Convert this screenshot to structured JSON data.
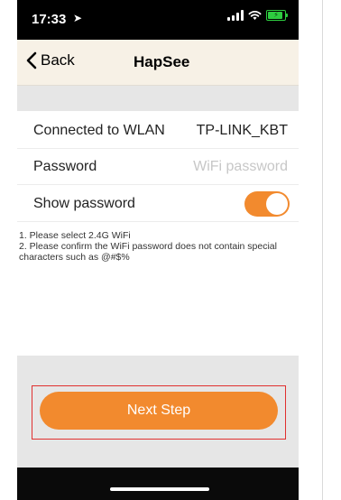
{
  "status_bar": {
    "time": "17:33",
    "location_glyph": "➤",
    "signal_icon": "cellular-signal-icon",
    "wifi_icon": "wifi-icon",
    "battery_icon": "battery-charging-icon",
    "battery_level": 0.9
  },
  "nav": {
    "back_label": "Back",
    "back_icon": "chevron-left-icon",
    "title": "HapSee"
  },
  "settings": {
    "wlan_label": "Connected to WLAN",
    "wlan_value": "TP-LINK_KBT",
    "password_label": "Password",
    "password_placeholder": "WiFi password",
    "password_value": "",
    "show_password_label": "Show password",
    "show_password_on": true
  },
  "notes": [
    "1. Please select 2.4G WiFi",
    "2. Please confirm the WiFi password does not contain special characters such as @#$%"
  ],
  "footer": {
    "next_label": "Next Step"
  },
  "colors": {
    "accent": "#f28a2e",
    "nav_bg": "#f7f1e6",
    "highlight": "#e0302f",
    "band_gray": "#e6e6e6"
  }
}
